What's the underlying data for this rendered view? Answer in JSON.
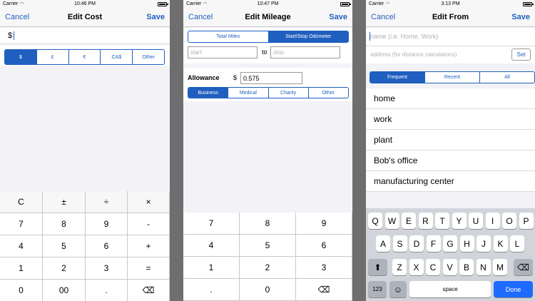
{
  "screen1": {
    "status": {
      "carrier": "Carrier",
      "time": "10:46 PM"
    },
    "nav": {
      "left": "Cancel",
      "title": "Edit Cost",
      "right": "Save"
    },
    "input_value": "$",
    "currencies": [
      "$",
      "£",
      "€",
      "CA$",
      "Other"
    ],
    "keypad": [
      [
        "C",
        "±",
        "÷",
        "×"
      ],
      [
        "7",
        "8",
        "9",
        "-"
      ],
      [
        "4",
        "5",
        "6",
        "+"
      ],
      [
        "1",
        "2",
        "3",
        "="
      ],
      [
        "0",
        "00",
        ".",
        "⌫"
      ]
    ]
  },
  "screen2": {
    "status": {
      "carrier": "Carrier",
      "time": "10:47 PM"
    },
    "nav": {
      "left": "Cancel",
      "title": "Edit Mileage",
      "right": "Save"
    },
    "mode_tabs": [
      "Total Miles",
      "Start/Stop Odometer"
    ],
    "start_placeholder": "start",
    "to_label": "to",
    "stop_placeholder": "stop",
    "allowance_label": "Allowance",
    "currency_symbol": "$",
    "allowance_value": "0.575",
    "categories": [
      "Business",
      "Medical",
      "Charity",
      "Other"
    ],
    "keypad": [
      [
        "7",
        "8",
        "9"
      ],
      [
        "4",
        "5",
        "6"
      ],
      [
        "1",
        "2",
        "3"
      ],
      [
        ".",
        "0",
        "⌫"
      ]
    ]
  },
  "screen3": {
    "status": {
      "carrier": "Carrier",
      "time": "3:13 PM"
    },
    "nav": {
      "left": "Cancel",
      "title": "Edit From",
      "right": "Save"
    },
    "name_placeholder": "name (i.e. Home, Work)",
    "address_placeholder": "address (for distance calculations)",
    "set_button": "Set",
    "tabs": [
      "Frequent",
      "Recent",
      "All"
    ],
    "locations": [
      "home",
      "work",
      "plant",
      "Bob's office",
      "manufacturing center"
    ],
    "keyboard": {
      "row1": [
        "Q",
        "W",
        "E",
        "R",
        "T",
        "Y",
        "U",
        "I",
        "O",
        "P"
      ],
      "row2": [
        "A",
        "S",
        "D",
        "F",
        "G",
        "H",
        "J",
        "K",
        "L"
      ],
      "row3": [
        "Z",
        "X",
        "C",
        "V",
        "B",
        "N",
        "M"
      ],
      "shift": "⬆",
      "delete": "⌫",
      "numbers": "123",
      "emoji": "☺",
      "space": "space",
      "done": "Done"
    }
  },
  "colors": {
    "accent": "#1f5fbf",
    "done_blue": "#1f6bff"
  }
}
